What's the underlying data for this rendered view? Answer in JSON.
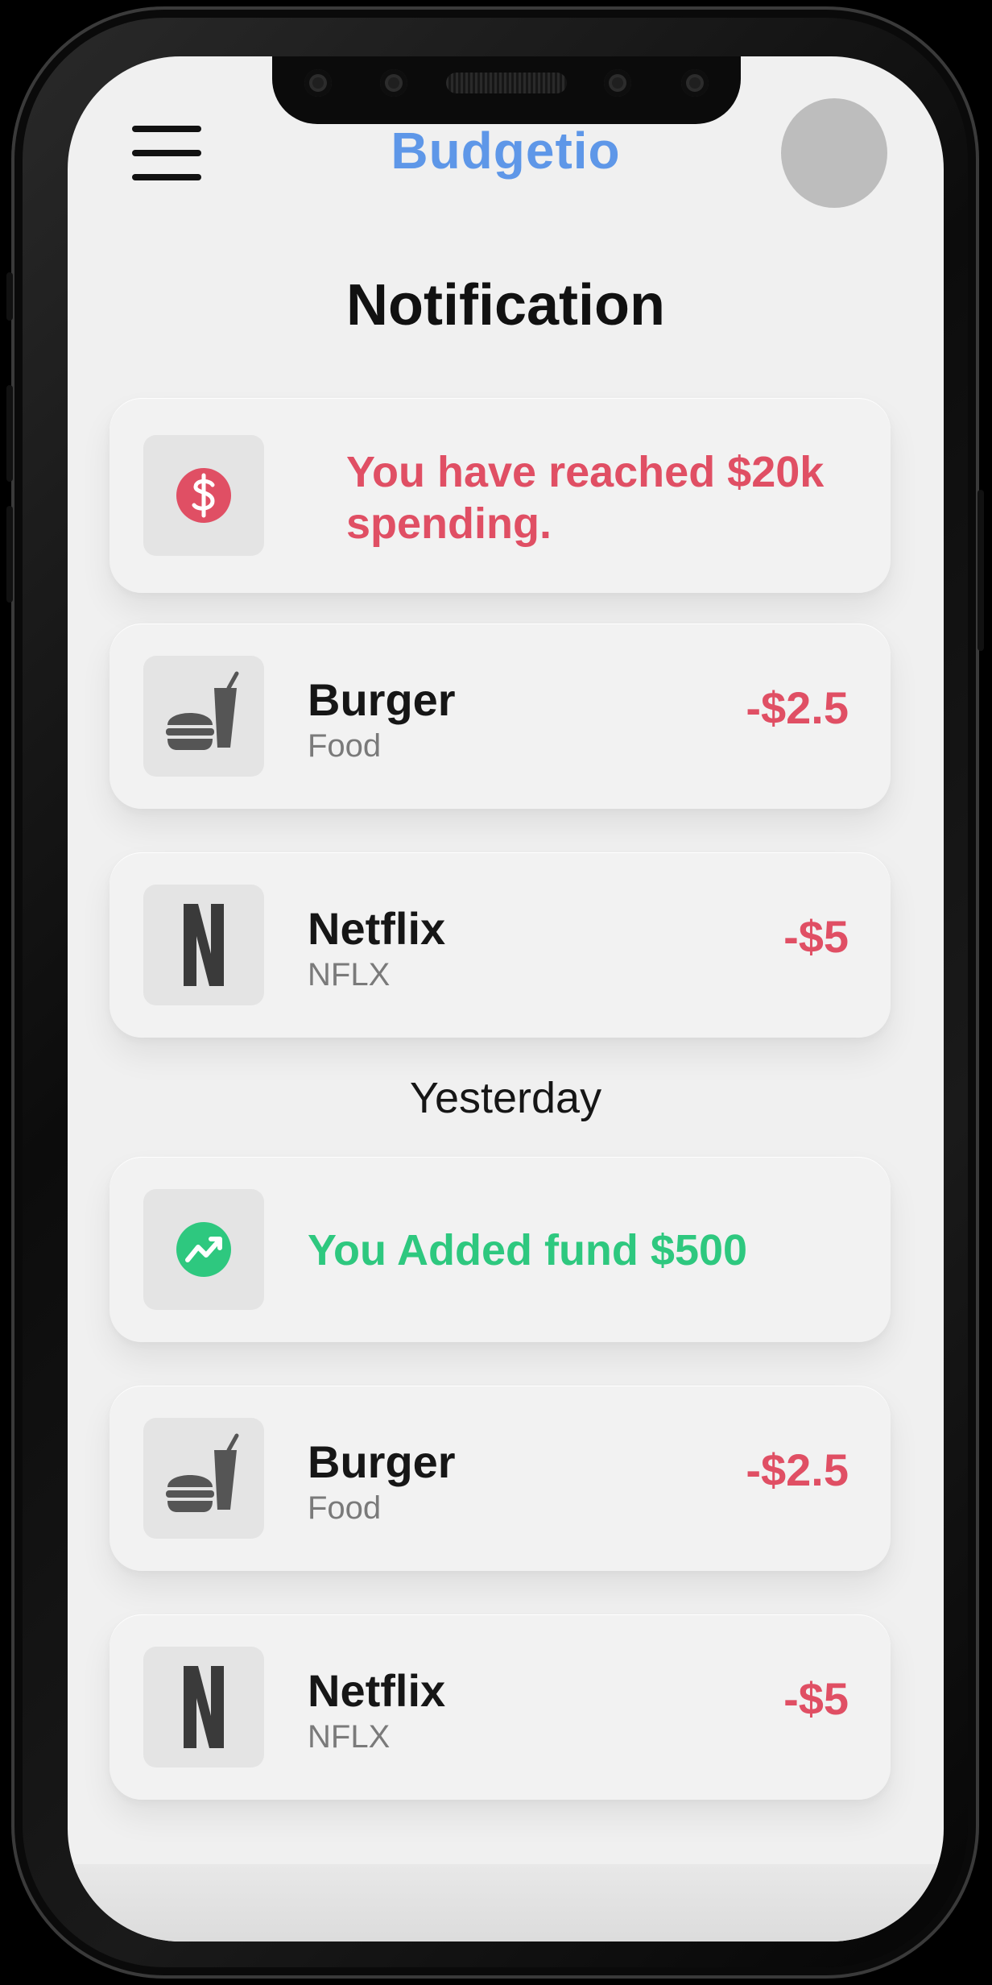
{
  "app": {
    "brand": "Budgetio",
    "page_title": "Notification"
  },
  "colors": {
    "brand": "#5e97e8",
    "negative": "#e04f64",
    "positive": "#2ec87f"
  },
  "today": {
    "alert": {
      "icon": "dollar-circle-icon",
      "text": "You have reached $20k spending."
    },
    "transactions": [
      {
        "icon": "fast-food-icon",
        "name": "Burger",
        "category": "Food",
        "amount": "-$2.5"
      },
      {
        "icon": "netflix-logo-icon",
        "name": "Netflix",
        "category": "NFLX",
        "amount": "-$5"
      }
    ]
  },
  "yesterday": {
    "label": "Yesterday",
    "alert": {
      "icon": "trending-up-icon",
      "text": "You Added fund $500"
    },
    "transactions": [
      {
        "icon": "fast-food-icon",
        "name": "Burger",
        "category": "Food",
        "amount": "-$2.5"
      },
      {
        "icon": "netflix-logo-icon",
        "name": "Netflix",
        "category": "NFLX",
        "amount": "-$5"
      }
    ]
  }
}
